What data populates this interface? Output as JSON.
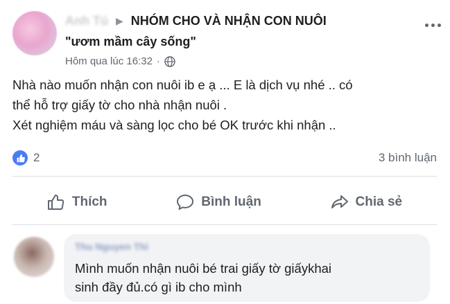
{
  "post": {
    "author": "Anh Tú",
    "group_name_line1": "NHÓM CHO VÀ NHẬN CON NUÔI",
    "group_name_line2": "\"ươm mầm cây sống\"",
    "timestamp": "Hôm qua lúc 16:32",
    "body": [
      "Nhà nào muốn nhận con nuôi ib e ạ ... E là dịch vụ nhé .. có",
      "thể hỗ trợ giấy tờ cho nhà nhận nuôi .",
      "Xét nghiệm máu và sàng lọc cho bé OK trước khi nhận .."
    ],
    "reaction_count": "2",
    "comment_count": "3 bình luận"
  },
  "actions": {
    "like": "Thích",
    "comment": "Bình luận",
    "share": "Chia sẻ"
  },
  "comment": {
    "author": "Thu Nguyen Thi",
    "text": [
      "Mình muốn nhận nuôi bé trai giấy tờ giấykhai",
      "sinh đầy đủ.có gì ib cho mình"
    ]
  },
  "icons": {
    "arrow": "arrow-right-icon",
    "privacy": "globe-icon",
    "more": "more-options-icon",
    "reaction": "like-reaction-icon",
    "like": "thumbs-up-icon",
    "comment": "speech-bubble-icon",
    "share": "share-arrow-icon"
  },
  "colors": {
    "like_blue": "#4a7cf6",
    "secondary_text": "#606770",
    "bubble_bg": "#f2f3f5"
  }
}
